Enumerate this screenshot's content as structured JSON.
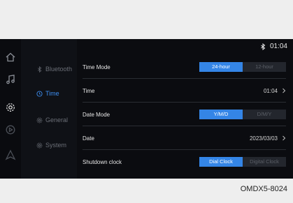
{
  "status": {
    "time": "01:04",
    "bluetooth_icon": "bluetooth-icon"
  },
  "rail_icons": [
    "home-icon",
    "music-icon",
    "settings-gear-icon",
    "media-circle-icon",
    "navigation-icon"
  ],
  "categories": [
    {
      "label": "Bluetooth",
      "icon": "bluetooth-icon",
      "active": false
    },
    {
      "label": "Time",
      "icon": "clock-icon",
      "active": true
    },
    {
      "label": "General",
      "icon": "gear-icon",
      "active": false
    },
    {
      "label": "System",
      "icon": "gear-icon",
      "active": false
    }
  ],
  "settings": {
    "time_mode": {
      "label": "Time Mode",
      "options": [
        "24-hour",
        "12-hour"
      ],
      "selected": "24-hour"
    },
    "time": {
      "label": "Time",
      "value": "01:04"
    },
    "date_mode": {
      "label": "Date Mode",
      "options": [
        "Y/M/D",
        "D/M/Y"
      ],
      "selected": "Y/M/D"
    },
    "date": {
      "label": "Date",
      "value": "2023/03/03"
    },
    "shutdown_clock": {
      "label": "Shutdown clock",
      "options": [
        "Dial Clock",
        "Digital Clock"
      ],
      "selected": "Dial Clock"
    }
  },
  "caption": "OMDX5-8024",
  "colors": {
    "accent": "#3485e6",
    "active_category": "#3d8ef1",
    "background": "#0b0c10"
  }
}
